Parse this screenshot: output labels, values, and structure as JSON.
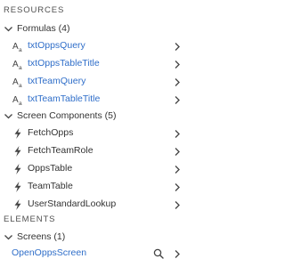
{
  "resources": {
    "title": "RESOURCES",
    "formulas": {
      "label": "Formulas (4)",
      "items": [
        {
          "label": "txtOppsQuery",
          "icon": "formula-icon"
        },
        {
          "label": "txtOppsTableTitle",
          "icon": "formula-icon"
        },
        {
          "label": "txtTeamQuery",
          "icon": "formula-icon"
        },
        {
          "label": "txtTeamTableTitle",
          "icon": "formula-icon"
        }
      ]
    },
    "screen_components": {
      "label": "Screen Components (5)",
      "items": [
        {
          "label": "FetchOpps",
          "icon": "lightning-icon"
        },
        {
          "label": "FetchTeamRole",
          "icon": "lightning-icon"
        },
        {
          "label": "OppsTable",
          "icon": "lightning-icon"
        },
        {
          "label": "TeamTable",
          "icon": "lightning-icon"
        },
        {
          "label": "UserStandardLookup",
          "icon": "lightning-icon"
        }
      ]
    }
  },
  "elements": {
    "title": "ELEMENTS",
    "screens": {
      "label": "Screens (1)",
      "items": [
        {
          "label": "OpenOppsScreen"
        }
      ]
    }
  },
  "colors": {
    "link": "#2f6ec9",
    "text": "#333333",
    "section": "#505050",
    "icon": "#444444"
  }
}
